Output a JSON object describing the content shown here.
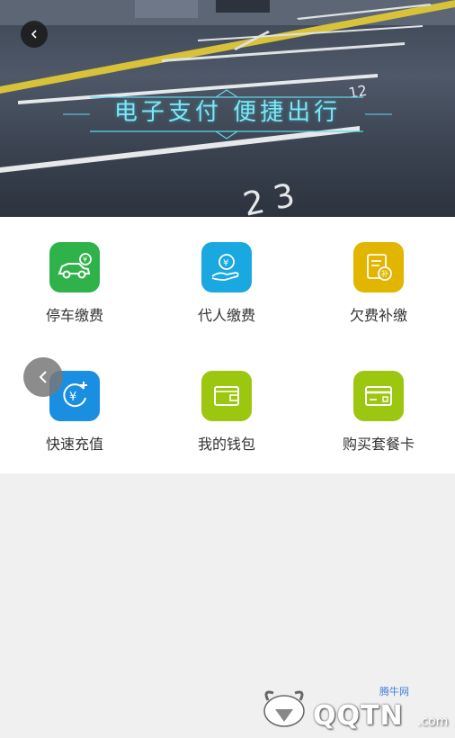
{
  "banner": {
    "title": "电子支付  便捷出行"
  },
  "services": [
    {
      "label": "停车缴费",
      "icon": "car-payment-icon",
      "color": "#2fb24a"
    },
    {
      "label": "代人缴费",
      "icon": "hand-payment-icon",
      "color": "#1aa8e0"
    },
    {
      "label": "欠费补缴",
      "icon": "bill-icon",
      "color": "#e1b500"
    },
    {
      "label": "快速充值",
      "icon": "recharge-icon",
      "color": "#1a8ee0"
    },
    {
      "label": "我的钱包",
      "icon": "wallet-icon",
      "color": "#9cc711"
    },
    {
      "label": "购买套餐卡",
      "icon": "card-icon",
      "color": "#9cc711"
    }
  ],
  "watermark": {
    "brand": "QQTN",
    "suffix": ".com",
    "tag": "腾牛网"
  }
}
